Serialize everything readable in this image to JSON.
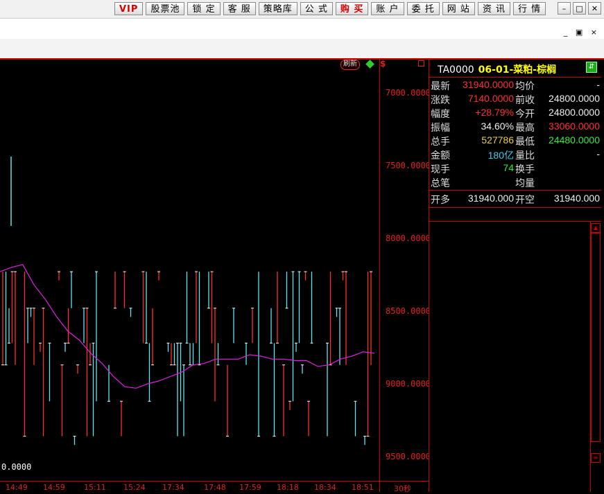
{
  "toolbar": {
    "vip": "VIP",
    "stock_pool": "股票池",
    "lock": "锁 定",
    "service": "客 服",
    "strategy": "策略库",
    "formula": "公 式",
    "buy": "购 买",
    "account": "账 户",
    "entrust": "委 托",
    "website": "网 站",
    "info": "资 讯",
    "quotes": "行 情"
  },
  "window_controls": {
    "minimize": "–",
    "maximize": "□",
    "close": "✕"
  },
  "sub_controls": "_ ▣ ×",
  "chart": {
    "refresh_label": "刷新",
    "dollar": "$",
    "y_labels": [
      "7000.0000",
      "7500.0000",
      "8000.0000",
      "8500.0000",
      "9000.0000",
      "9500.0000"
    ],
    "y_values": [
      7000,
      7500,
      8000,
      8500,
      9000,
      9500
    ],
    "x_labels": [
      "14:49",
      "14:59",
      "15:11",
      "15:24",
      "17:34",
      "17:48",
      "17:59",
      "18:18",
      "18:34",
      "18:51",
      "30秒"
    ],
    "left_price_label": "0.0000",
    "colors": {
      "up": "#ff3030",
      "down": "#5fe8f0",
      "avg": "#e020e0",
      "neutral": "#ffffff"
    },
    "avg_line": [
      8229,
      8200,
      8180,
      8320,
      8420,
      8540,
      8640,
      8700,
      8790,
      8860,
      8950,
      9020,
      9030,
      9000,
      8980,
      8950,
      8920,
      8870,
      8860,
      8830,
      8830,
      8830,
      8800,
      8810,
      8830,
      8830,
      8840,
      8840,
      8880,
      8870,
      8830,
      8810,
      8780,
      8790
    ]
  },
  "panel": {
    "code": "TA0000",
    "title": "06-01-菜粕-棕榈",
    "refresh_icon": "⇵",
    "rows": [
      {
        "l1": "最新",
        "v1": "31940.0000",
        "c1": "red",
        "l2": "均价",
        "v2": "-",
        "c2": "white"
      },
      {
        "l1": "涨跌",
        "v1": "7140.0000",
        "c1": "red",
        "l2": "前收",
        "v2": "24800.0000",
        "c2": "white"
      },
      {
        "l1": "幅度",
        "v1": "+28.79%",
        "c1": "red",
        "l2": "今开",
        "v2": "24800.0000",
        "c2": "white"
      },
      {
        "l1": "振幅",
        "v1": "34.60%",
        "c1": "white",
        "l2": "最高",
        "v2": "33060.0000",
        "c2": "red"
      },
      {
        "l1": "总手",
        "v1": "527786",
        "c1": "yellow",
        "l2": "最低",
        "v2": "24480.0000",
        "c2": "green"
      },
      {
        "l1": "金额",
        "v1": "180亿",
        "c1": "cyan",
        "l2": "量比",
        "v2": "-",
        "c2": "white"
      },
      {
        "l1": "现手",
        "v1": "74",
        "c1": "green",
        "l2": "换手",
        "v2": "",
        "c2": "white"
      },
      {
        "l1": "总笔",
        "v1": "",
        "c1": "white",
        "l2": "均量",
        "v2": "",
        "c2": "white"
      }
    ],
    "open_row": {
      "l1": "开多",
      "v1": "31940.000",
      "l2": "开空",
      "v2": "31940.000"
    }
  }
}
